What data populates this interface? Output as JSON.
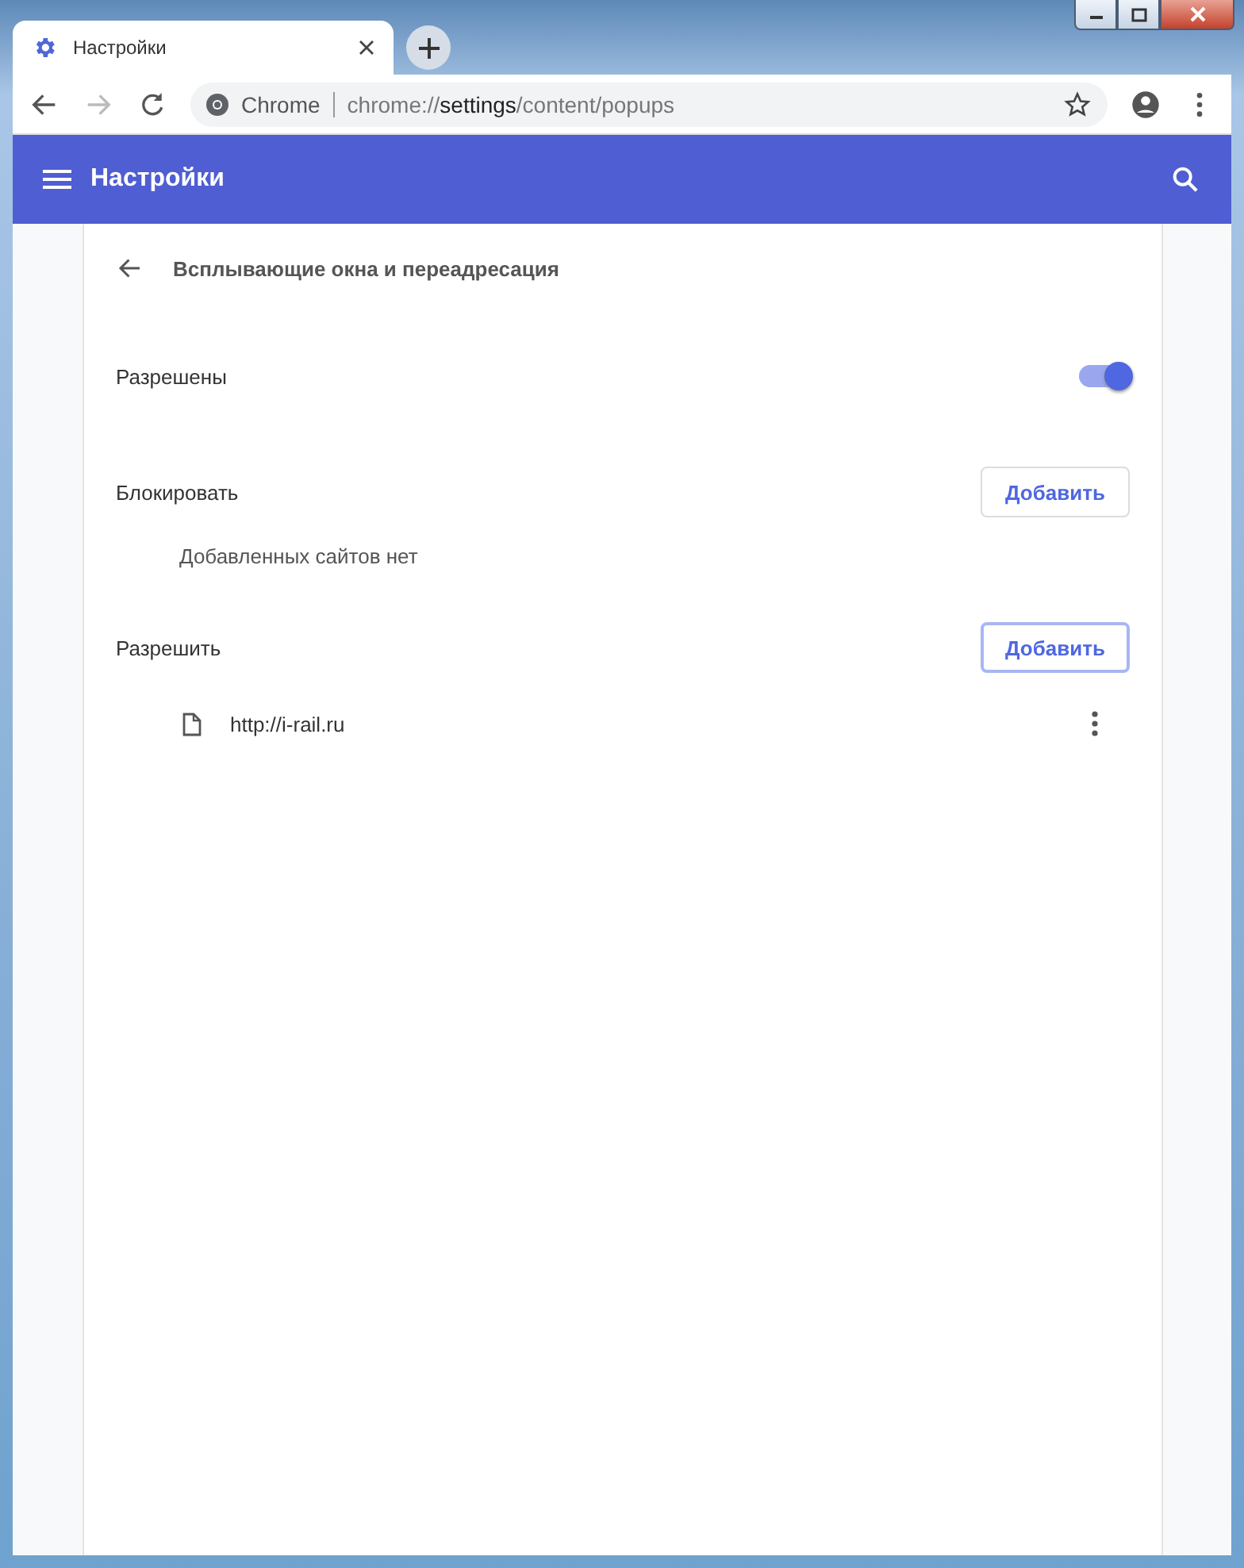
{
  "tab": {
    "title": "Настройки",
    "selected": true
  },
  "toolbar": {
    "forward_disabled": true,
    "site_label": "Chrome",
    "url": {
      "scheme": "chrome://",
      "host": "settings",
      "path": "/content/popups"
    }
  },
  "header": {
    "title": "Настройки"
  },
  "page": {
    "title": "Всплывающие окна и переадресация",
    "toggle": {
      "label": "Разрешены",
      "on": true
    },
    "sections": [
      {
        "title": "Блокировать",
        "button": {
          "label": "Добавить",
          "focused": false
        },
        "empty_text": "Добавленных сайтов нет"
      },
      {
        "title": "Разрешить",
        "button": {
          "label": "Добавить",
          "focused": true
        },
        "sites": [
          "http://i-rail.ru"
        ]
      }
    ]
  }
}
